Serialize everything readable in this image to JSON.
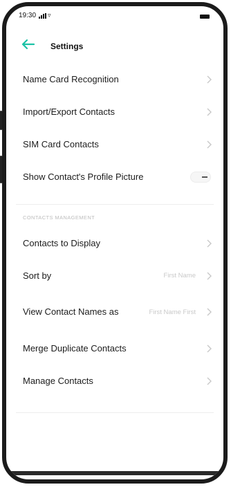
{
  "status_bar": {
    "time": "19:30",
    "wifi_icon": "wifi-icon",
    "battery_icon": "battery-icon"
  },
  "header": {
    "title": "Settings",
    "back_icon": "back-arrow-icon"
  },
  "accent_color": "#1bc2a6",
  "top_items": [
    {
      "label": "Name Card Recognition"
    },
    {
      "label": "Import/Export Contacts"
    },
    {
      "label": "SIM Card Contacts"
    },
    {
      "label": "Show Contact's Profile Picture",
      "toggle": "off"
    }
  ],
  "management_section": {
    "header": "CONTACTS MANAGEMENT",
    "items": [
      {
        "label": "Contacts to Display"
      },
      {
        "label": "Sort by",
        "value": "First Name"
      },
      {
        "label": "View Contact Names as",
        "value": "First Name First"
      },
      {
        "label": "Merge Duplicate Contacts"
      },
      {
        "label": "Manage Contacts"
      }
    ]
  }
}
